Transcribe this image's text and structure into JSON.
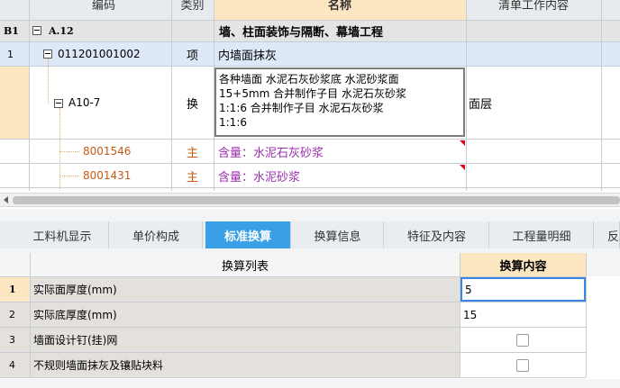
{
  "top_table": {
    "headers": {
      "code": "编码",
      "type": "类别",
      "name": "名称",
      "work": "清单工作内容"
    },
    "rows": [
      {
        "idx": "B1",
        "code": "A.12",
        "type": "",
        "name": "墙、柱面装饰与隔断、幕墙工程",
        "work": ""
      },
      {
        "idx": "1",
        "code": "011201001002",
        "type": "项",
        "name": "内墙面抹灰",
        "work": ""
      },
      {
        "idx": "",
        "code": "A10-7",
        "type": "换",
        "name_lines": [
          "各种墙面 水泥石灰砂浆底 水泥砂浆面",
          "15+5mm  合并制作子目 水泥石灰砂浆",
          "1:1:6  合并制作子目 水泥石灰砂浆",
          "1:1:6"
        ],
        "work": "面层"
      },
      {
        "idx": "",
        "code": "8001546",
        "type": "主",
        "name": "含量：水泥石灰砂浆",
        "work": ""
      },
      {
        "idx": "",
        "code": "8001431",
        "type": "主",
        "name": "含量：水泥砂浆",
        "work": ""
      }
    ]
  },
  "tabs": [
    {
      "label": "工料机显示",
      "active": false
    },
    {
      "label": "单价构成",
      "active": false
    },
    {
      "label": "标准换算",
      "active": true
    },
    {
      "label": "换算信息",
      "active": false
    },
    {
      "label": "特征及内容",
      "active": false
    },
    {
      "label": "工程量明细",
      "active": false
    },
    {
      "label": "反",
      "active": false
    }
  ],
  "bottom_table": {
    "headers": {
      "list": "换算列表",
      "content": "换算内容"
    },
    "rows": [
      {
        "idx": "1",
        "label": "实际面厚度(mm)",
        "value": "5",
        "kind": "input"
      },
      {
        "idx": "2",
        "label": "实际底厚度(mm)",
        "value": "15",
        "kind": "text"
      },
      {
        "idx": "3",
        "label": "墙面设计钉(挂)网",
        "value": "",
        "kind": "checkbox"
      },
      {
        "idx": "4",
        "label": "不规则墙面抹灰及镶贴块料",
        "value": "",
        "kind": "checkbox"
      }
    ]
  },
  "colors": {
    "header_bg": "#e8ebee",
    "name_header_bg": "#fde7c2",
    "selected_row_bg": "#dde9f8",
    "material_text": "#9b2fae",
    "material_code": "#c65a13",
    "tab_active": "#3aa0e6",
    "bottom_header_bg": "#f5f5f5",
    "content_header_bg": "#fde7c2"
  }
}
